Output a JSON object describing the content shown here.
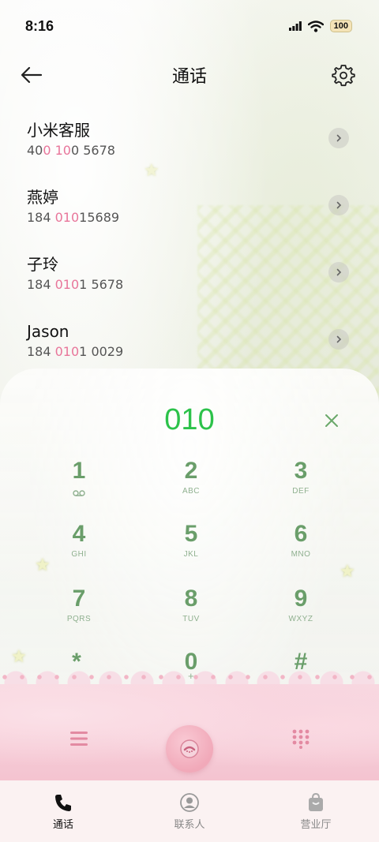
{
  "status_bar": {
    "time": "8:16",
    "battery": "100"
  },
  "header": {
    "title": "通话",
    "back_icon": "arrow-left-icon",
    "settings_icon": "gear-icon"
  },
  "contacts": [
    {
      "name": "小米客服",
      "number_parts": [
        "40",
        "0 10",
        "0 5678"
      ]
    },
    {
      "name": "燕婷",
      "number_parts": [
        "184 ",
        "010",
        "15689"
      ]
    },
    {
      "name": "子玲",
      "number_parts": [
        "184 ",
        "010",
        "1 5678"
      ]
    },
    {
      "name": "Jason",
      "number_parts": [
        "184 ",
        "010",
        "1 0029"
      ]
    }
  ],
  "dialpad": {
    "input": "010",
    "keys": [
      {
        "digit": "1",
        "letters": ""
      },
      {
        "digit": "2",
        "letters": "ABC"
      },
      {
        "digit": "3",
        "letters": "DEF"
      },
      {
        "digit": "4",
        "letters": "GHI"
      },
      {
        "digit": "5",
        "letters": "JKL"
      },
      {
        "digit": "6",
        "letters": "MNO"
      },
      {
        "digit": "7",
        "letters": "PQRS"
      },
      {
        "digit": "8",
        "letters": "TUV"
      },
      {
        "digit": "9",
        "letters": "WXYZ"
      },
      {
        "digit": "*",
        "letters": ","
      },
      {
        "digit": "0",
        "letters": "+"
      },
      {
        "digit": "#",
        "letters": ""
      }
    ],
    "colors": {
      "input": "#2cc24a",
      "keys": "#6a9e6a",
      "highlight": "#e8759a"
    }
  },
  "bottom_nav": {
    "items": [
      {
        "label": "通话",
        "icon": "phone-icon",
        "active": true
      },
      {
        "label": "联系人",
        "icon": "contact-icon",
        "active": false
      },
      {
        "label": "营业厅",
        "icon": "shopping-bag-icon",
        "active": false
      }
    ]
  }
}
